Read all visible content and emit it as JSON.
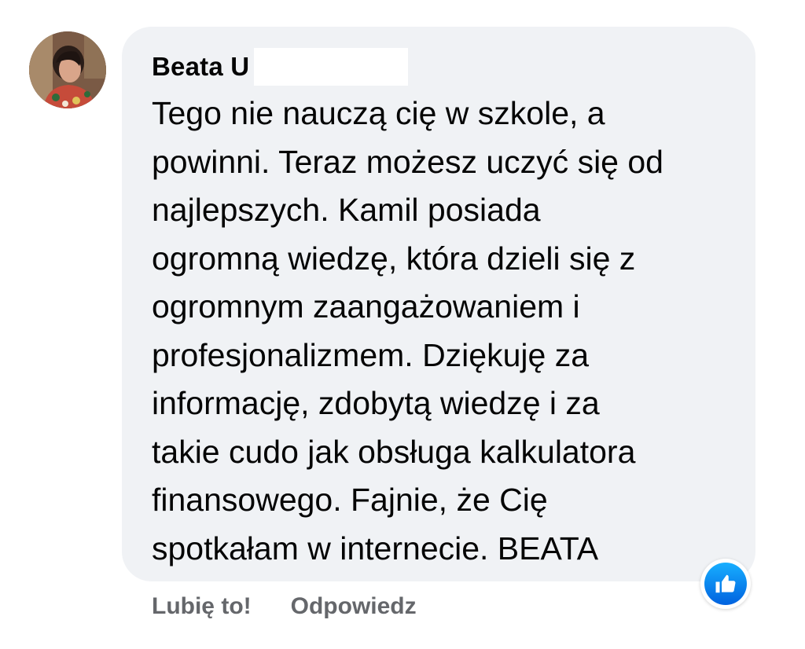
{
  "comment": {
    "author": "Beata U",
    "text": "Tego nie nauczą cię w szkole, a\npowinni. Teraz możesz uczyć się od\nnajlepszych. Kamil posiada\nogromną wiedzę, która dzieli się z\nogromnym zaangażowaniem i\nprofesjonalizmem. Dziękuję za\ninformację, zdobytą wiedzę i za\ntakie cudo jak obsługa kalkulatora\nfinansowego. Fajnie, że Cię\nspotkałam w internecie. BEATA"
  },
  "actions": {
    "like_label": "Lubię to!",
    "reply_label": "Odpowiedz"
  },
  "reactions": {
    "icon": "thumbs-up-icon",
    "color": "#1877f2"
  },
  "colors": {
    "bubble_bg": "#f0f2f5",
    "text": "#050505",
    "secondary_text": "#65676b"
  }
}
